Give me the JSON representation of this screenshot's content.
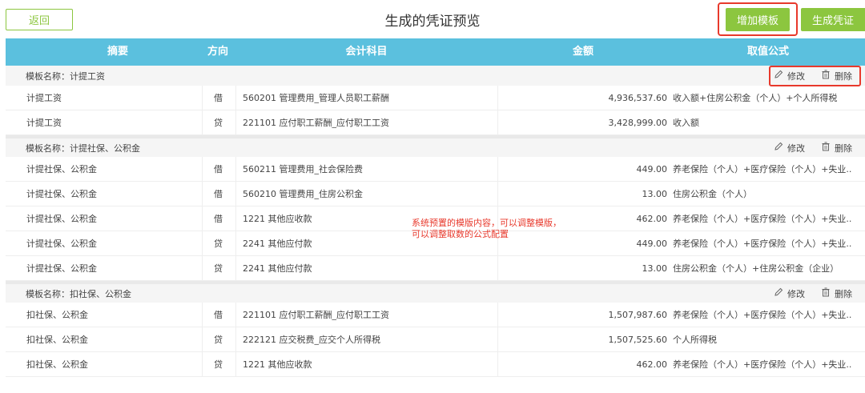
{
  "header": {
    "back_label": "返回",
    "title": "生成的凭证预览",
    "add_template_label": "增加模板",
    "generate_label": "生成凭证"
  },
  "columns": [
    "摘要",
    "方向",
    "会计科目",
    "金额",
    "取值公式"
  ],
  "actions": {
    "edit_label": "修改",
    "delete_label": "删除"
  },
  "annotation": {
    "line1": "系统预置的模版内容，可以调整模版，",
    "line2": "可以调整取数的公式配置"
  },
  "groups": [
    {
      "name": "模板名称：计提工资",
      "rows": [
        {
          "summary": "计提工资",
          "dir": "借",
          "account": "560201 管理费用_管理人员职工薪酬",
          "amount": "4,936,537.60",
          "formula": "收入额+住房公积金（个人）+个人所得税"
        },
        {
          "summary": "计提工资",
          "dir": "贷",
          "account": "221101 应付职工薪酬_应付职工工资",
          "amount": "3,428,999.00",
          "formula": "收入额"
        }
      ]
    },
    {
      "name": "模板名称：计提社保、公积金",
      "rows": [
        {
          "summary": "计提社保、公积金",
          "dir": "借",
          "account": "560211 管理费用_社会保险费",
          "amount": "449.00",
          "formula": "养老保险（个人）+医疗保险（个人）+失业..."
        },
        {
          "summary": "计提社保、公积金",
          "dir": "借",
          "account": "560210 管理费用_住房公积金",
          "amount": "13.00",
          "formula": "住房公积金（个人）"
        },
        {
          "summary": "计提社保、公积金",
          "dir": "借",
          "account": "1221 其他应收款",
          "amount": "462.00",
          "formula": "养老保险（个人）+医疗保险（个人）+失业..."
        },
        {
          "summary": "计提社保、公积金",
          "dir": "贷",
          "account": "2241 其他应付款",
          "amount": "449.00",
          "formula": "养老保险（个人）+医疗保险（个人）+失业..."
        },
        {
          "summary": "计提社保、公积金",
          "dir": "贷",
          "account": "2241 其他应付款",
          "amount": "13.00",
          "formula": "住房公积金（个人）+住房公积金（企业）"
        }
      ]
    },
    {
      "name": "模板名称：扣社保、公积金",
      "rows": [
        {
          "summary": "扣社保、公积金",
          "dir": "借",
          "account": "221101 应付职工薪酬_应付职工工资",
          "amount": "1,507,987.60",
          "formula": "养老保险（个人）+医疗保险（个人）+失业..."
        },
        {
          "summary": "扣社保、公积金",
          "dir": "贷",
          "account": "222121 应交税费_应交个人所得税",
          "amount": "1,507,525.60",
          "formula": "个人所得税"
        },
        {
          "summary": "扣社保、公积金",
          "dir": "贷",
          "account": "1221 其他应收款",
          "amount": "462.00",
          "formula": "养老保险（个人）+医疗保险（个人）+失业..."
        }
      ]
    }
  ]
}
